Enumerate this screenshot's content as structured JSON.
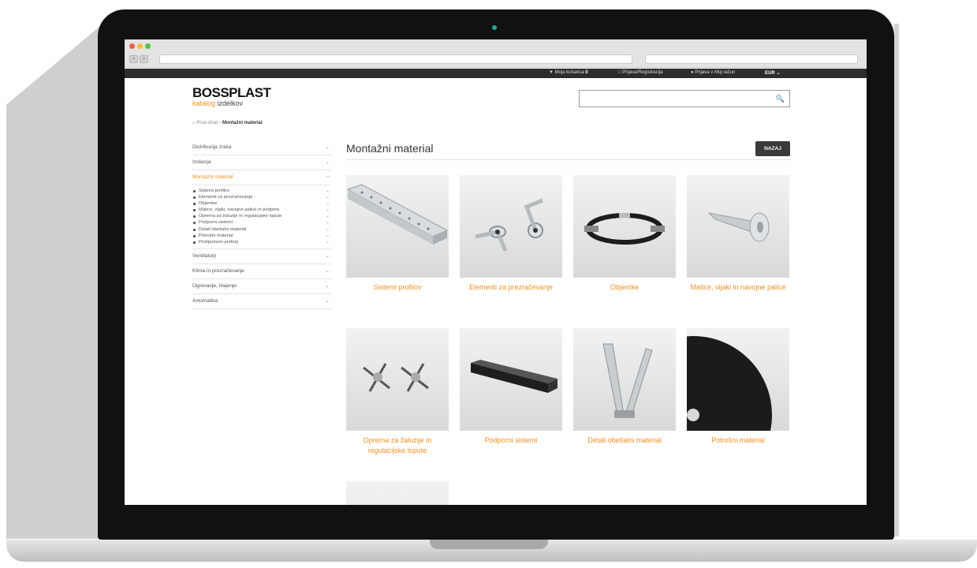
{
  "topbar": {
    "wishlist_label": "Moja košarica",
    "wishlist_count": "0",
    "login_register": "Prijava/Registracija",
    "account": "Prijava v Moj račun",
    "currency": "EUR"
  },
  "logo": {
    "name": "BOSSPLAST",
    "sub_colored": "katalog",
    "sub_plain": "izdelkov"
  },
  "breadcrumb": {
    "home": "Prva stran",
    "current": "Montažni material"
  },
  "sidebar": {
    "categories": [
      {
        "label": "Distribucija zraka"
      },
      {
        "label": "Izolacija"
      },
      {
        "label": "Montažni material",
        "active": true
      }
    ],
    "subitems": [
      "Sistemi profilov",
      "Elementi za prezračevanje",
      "Objemke",
      "Matice, vijaki, navojne palice in podpore",
      "Oprema za žaluzije in regulacijske lopute",
      "Podporni sistemi",
      "Detali obešalni material",
      "Potrošni material",
      "Protipožarni preboji"
    ],
    "categories_after": [
      {
        "label": "Ventilatorji"
      },
      {
        "label": "Klima in prezračevanje"
      },
      {
        "label": "Ogrevanje, hlajenje"
      },
      {
        "label": "Avtomatika"
      }
    ]
  },
  "main": {
    "title": "Montažni material",
    "back_button": "NAZAJ",
    "products": [
      {
        "label": "Sistemi profilov",
        "icon": "rail-profile-image"
      },
      {
        "label": "Elementi za prezračevanje",
        "icon": "ventilation-element-image"
      },
      {
        "label": "Objemke",
        "icon": "clamp-image"
      },
      {
        "label": "Matice, vijaki in navojne palice",
        "icon": "screw-image"
      },
      {
        "label": "Oprema za žaluzije in regulacijske lopute",
        "icon": "damper-fitting-image"
      },
      {
        "label": "Podporni sistemi",
        "icon": "support-rail-image"
      },
      {
        "label": "Detali obešalni material",
        "icon": "hanger-image"
      },
      {
        "label": "Potrošni material",
        "icon": "consumable-disc-image"
      },
      {
        "label": "",
        "icon": "product-image"
      }
    ]
  },
  "colors": {
    "accent": "#f28f22",
    "topbar": "#2d2d2d",
    "button": "#3a3a3a"
  }
}
